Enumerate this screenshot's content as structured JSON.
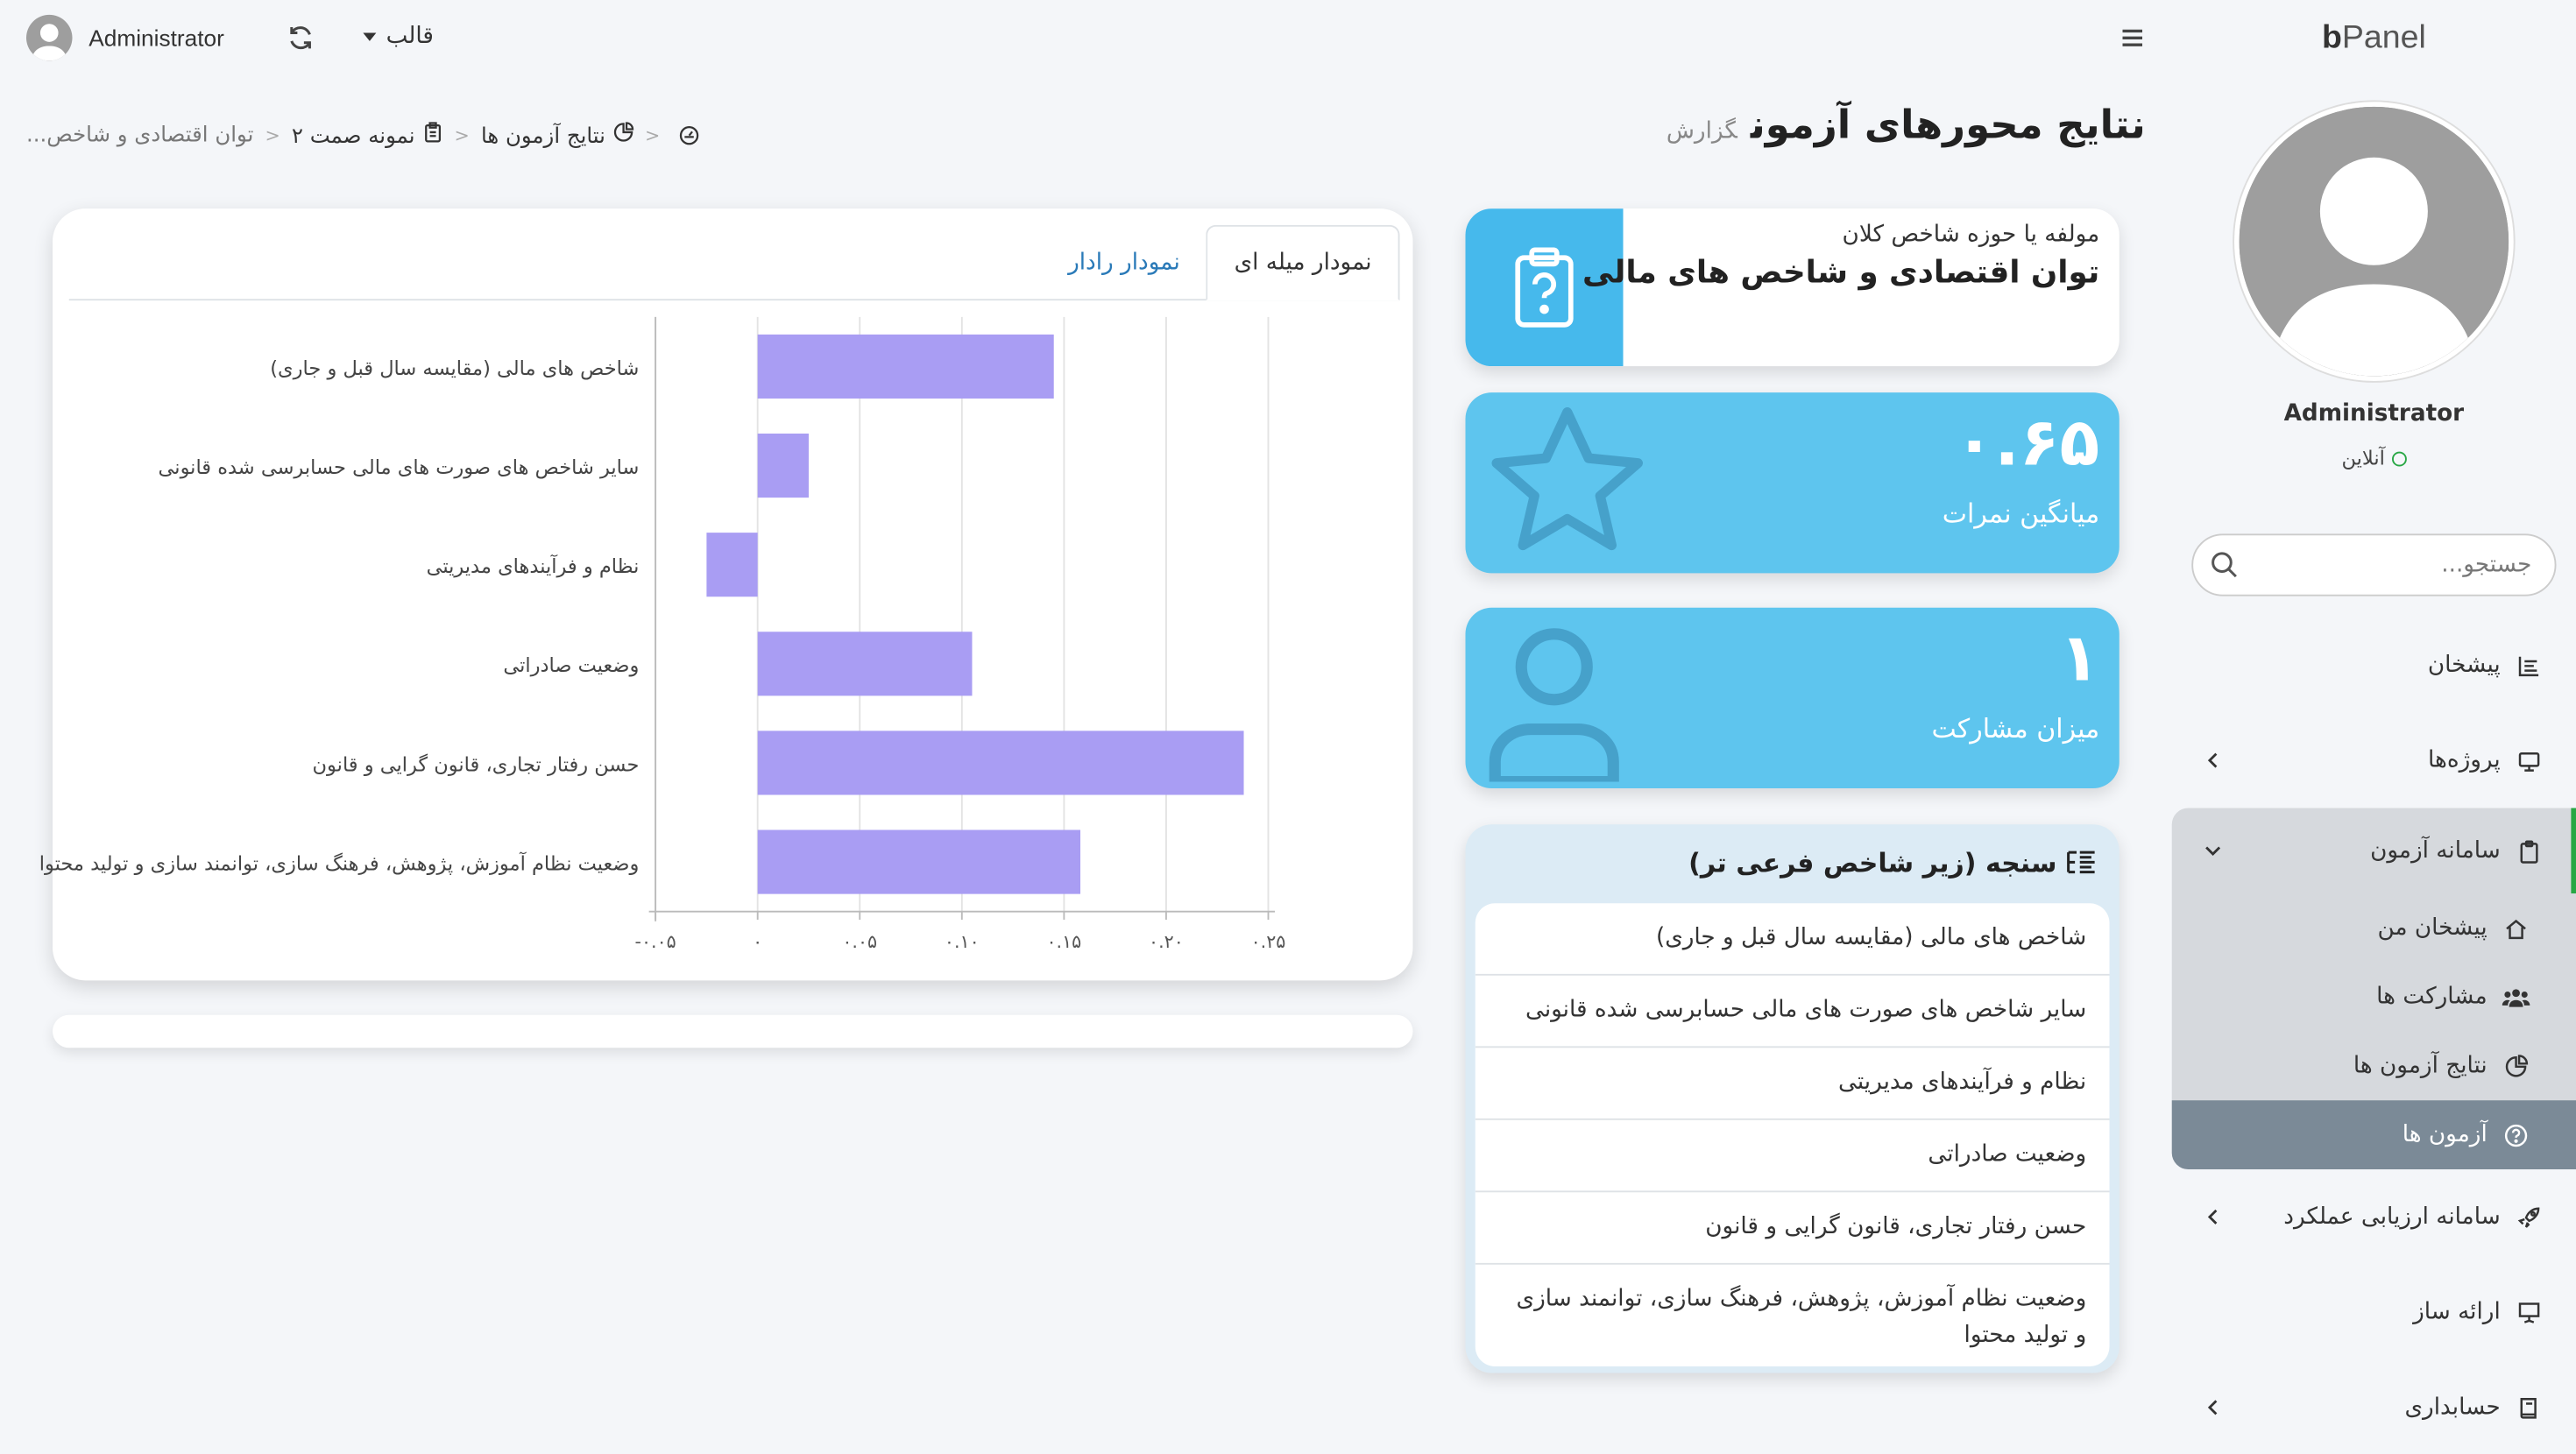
{
  "brand": {
    "prefix": "b",
    "name": "Panel"
  },
  "user": {
    "name": "Administrator",
    "status": "آنلاین"
  },
  "search": {
    "placeholder": "جستجو..."
  },
  "topbar": {
    "username": "Administrator",
    "template_label": "قالب"
  },
  "nav": {
    "items": [
      {
        "label": "پیشخان",
        "icon": "dashboard-icon"
      },
      {
        "label": "پروژه‌ها",
        "icon": "projects-icon"
      },
      {
        "label": "سامانه آزمون",
        "icon": "clipboard-icon",
        "expanded": true,
        "children": [
          {
            "label": "پیشخان من",
            "icon": "home-icon"
          },
          {
            "label": "مشارکت ها",
            "icon": "users-icon"
          },
          {
            "label": "نتایج آزمون ها",
            "icon": "chart-pie-icon"
          },
          {
            "label": "آزمون ها",
            "icon": "question-circle-icon",
            "active": true
          }
        ]
      },
      {
        "label": "سامانه ارزیابی عملکرد",
        "icon": "rocket-icon"
      },
      {
        "label": "ارائه ساز",
        "icon": "presentation-icon"
      },
      {
        "label": "حسابداری",
        "icon": "book-icon"
      }
    ]
  },
  "header": {
    "title": "نتایج محورهای آزمون",
    "subtitle": "گزارش"
  },
  "breadcrumb": {
    "items": [
      "نتایج آزمون ها",
      "نمونه صمت ۲",
      "توان اقتصادی و شاخص..."
    ]
  },
  "axis_card": {
    "label": "مولفه یا حوزه شاخص کلان",
    "value": "توان اقتصادی و شاخص های مالی"
  },
  "stats": {
    "average": {
      "value": "۰.۶۵",
      "caption": "میانگین نمرات"
    },
    "participation": {
      "value": "۱",
      "caption": "میزان مشارکت"
    }
  },
  "measures": {
    "title": "سنجه (زیر شاخص فرعی تر)",
    "items": [
      "شاخص های مالی (مقایسه سال قبل و جاری)",
      "سایر شاخص های صورت های مالی حسابرسی شده قانونی",
      "نظام و فرآیندهای مدیریتی",
      "وضعیت صادراتی",
      "حسن رفتار تجاری، قانون گرایی و قانون",
      "وضعیت نظام آموزش، پژوهش، فرهنگ سازی، توانمند سازی و تولید محتوا"
    ]
  },
  "tabs": {
    "bar": "نمودار میله ای",
    "radar": "نمودار رادار"
  },
  "colors": {
    "bar": "#a99df3",
    "stat": "#5ec5ee",
    "accent": "#46b9ec",
    "active_nav": "#7b8a97",
    "status_green": "#28a745"
  },
  "chart_data": {
    "type": "bar",
    "orientation": "horizontal",
    "categories": [
      "شاخص های مالی (مقایسه سال قبل و جاری)",
      "سایر شاخص های صورت های مالی حسابرسی شده قانونی",
      "نظام و فرآیندهای مدیریتی",
      "وضعیت صادراتی",
      "حسن رفتار تجاری، قانون گرایی و قانون",
      "وضعیت نظام آموزش، پژوهش، فرهنگ سازی، توانمند سازی و تولید محتوا"
    ],
    "values": [
      0.145,
      0.025,
      -0.025,
      0.105,
      0.238,
      0.158
    ],
    "xlim": [
      -0.05,
      0.25
    ],
    "ticks": [
      -0.05,
      0,
      0.05,
      0.1,
      0.15,
      0.2,
      0.25
    ],
    "tick_labels": [
      "۰.۰۵-",
      "۰",
      "۰.۰۵",
      "۰.۱۰",
      "۰.۱۵",
      "۰.۲۰",
      "۰.۲۵"
    ],
    "grid": true
  }
}
